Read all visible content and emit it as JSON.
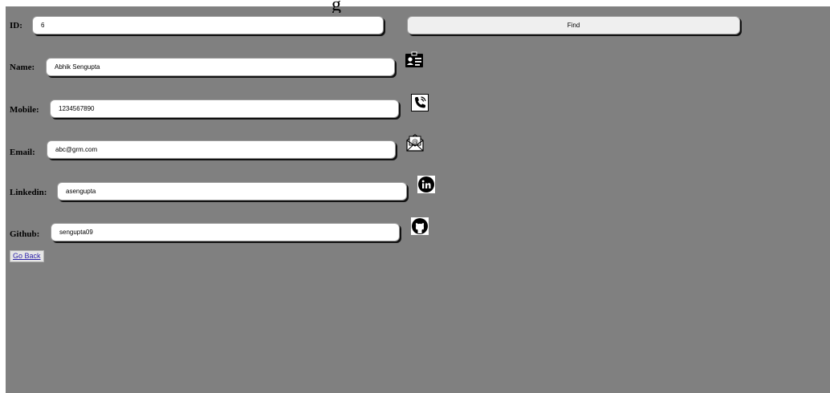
{
  "top_glyph": "g",
  "id": {
    "label": "ID:",
    "value": "6"
  },
  "find_button": "Find",
  "name": {
    "label": "Name:",
    "value": "Abhik Sengupta"
  },
  "mobile": {
    "label": "Mobile:",
    "value": "1234567890"
  },
  "email": {
    "label": "Email:",
    "value": "abc@grm.com"
  },
  "linkedin": {
    "label": "Linkedin:",
    "value": "asengupta"
  },
  "github": {
    "label": "Github:",
    "value": "sengupta09"
  },
  "go_back": "Go Back",
  "icons": [
    "id-card-icon",
    "phone-icon",
    "mail-icon",
    "linkedin-icon",
    "github-icon"
  ],
  "colors": {
    "panel": "#808080",
    "field": "#ffffff",
    "button": "#efefef",
    "link": "#2a1fa8"
  }
}
